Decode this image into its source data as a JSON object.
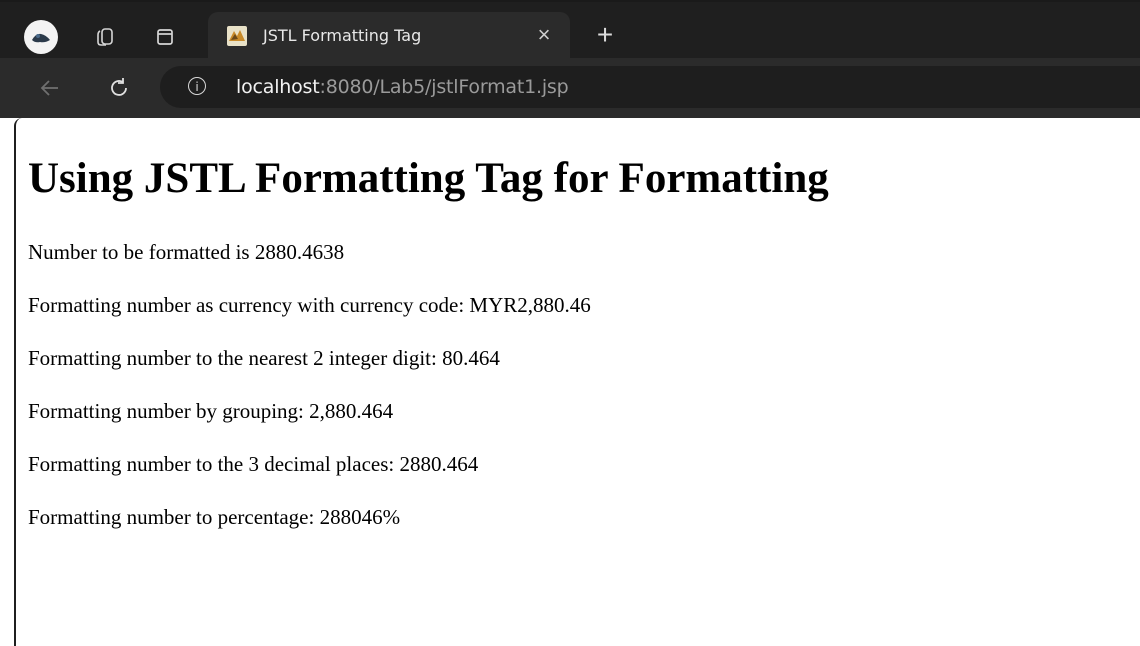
{
  "browser": {
    "tab": {
      "title": "JSTL Formatting Tag"
    },
    "address": {
      "host": "localhost",
      "rest": ":8080/Lab5/jstlFormat1.jsp"
    }
  },
  "page": {
    "heading": "Using JSTL Formatting Tag for Formatting",
    "lines": [
      "Number to be formatted is 2880.4638",
      "Formatting number as currency with currency code: MYR2,880.46",
      "Formatting number to the nearest 2 integer digit: 80.464",
      "Formatting number by grouping: 2,880.464",
      "Formatting number to the 3 decimal places: 2880.464",
      "Formatting number to percentage: 288046%"
    ]
  }
}
